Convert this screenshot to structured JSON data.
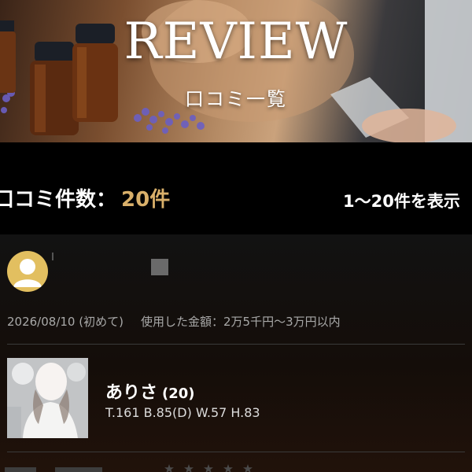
{
  "hero": {
    "title": "REVIEW",
    "subtitle": "口コミ一覧"
  },
  "summary": {
    "count_label": "口コミ件数：",
    "count_value": "20件",
    "range_text": "1〜20件を表示"
  },
  "review": {
    "date": "2026/08/10",
    "visit_type": "(初めて)",
    "amount_label": "使用した金額：",
    "amount_value": "2万5千円〜3万円以内",
    "cast": {
      "name": "ありさ",
      "age": "(20)",
      "stats": "T.161 B.85(D) W.57 H.83"
    },
    "rating": 5
  },
  "colors": {
    "accent_gold": "#d9b06a",
    "avatar_bg": "#e2bf60",
    "background": "#000000",
    "card_bg": "#121212",
    "meta_text": "#a9a9a9"
  },
  "icons": {
    "avatar": "user-avatar-icon",
    "star": "star-icon"
  }
}
